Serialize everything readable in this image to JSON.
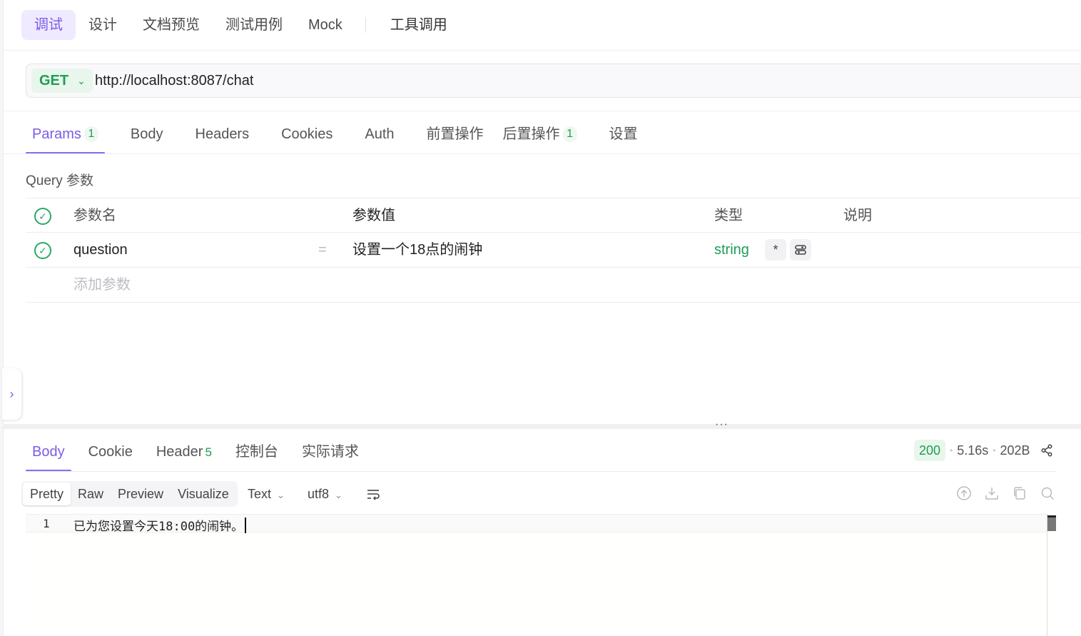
{
  "top_tabs": {
    "items": [
      {
        "label": "调试",
        "active": true
      },
      {
        "label": "设计"
      },
      {
        "label": "文档预览"
      },
      {
        "label": "测试用例"
      },
      {
        "label": "Mock"
      }
    ],
    "extra": "工具调用"
  },
  "request": {
    "method": "GET",
    "url": "http://localhost:8087/chat"
  },
  "request_tabs": [
    {
      "label": "Params",
      "count": "1"
    },
    {
      "label": "Body"
    },
    {
      "label": "Headers"
    },
    {
      "label": "Cookies"
    },
    {
      "label": "Auth"
    },
    {
      "label": "前置操作"
    },
    {
      "label": "后置操作",
      "count": "1"
    },
    {
      "label": "设置"
    }
  ],
  "query": {
    "section_label": "Query 参数",
    "columns": {
      "name": "参数名",
      "value": "参数值",
      "type": "类型",
      "desc": "说明"
    },
    "rows": [
      {
        "name": "question",
        "eq": "=",
        "value": "设置一个18点的闹钟",
        "type": "string",
        "required_mark": "*"
      }
    ],
    "add_placeholder": "添加参数"
  },
  "response_tabs": [
    {
      "label": "Body",
      "active": true
    },
    {
      "label": "Cookie"
    },
    {
      "label": "Header",
      "count": "5"
    },
    {
      "label": "控制台"
    },
    {
      "label": "实际请求"
    }
  ],
  "response_meta": {
    "status": "200",
    "time": "5.16s",
    "size": "202B"
  },
  "view_modes": [
    "Pretty",
    "Raw",
    "Preview",
    "Visualize"
  ],
  "format": {
    "type": "Text",
    "encoding": "utf8"
  },
  "editor": {
    "line_number": "1",
    "content": "已为您设置今天18:00的闹钟。"
  },
  "colors": {
    "accent": "#7b5ce6",
    "success": "#1f9d55"
  },
  "icons": [
    "chevron-down-icon",
    "check-icon",
    "share-icon",
    "wrap-lines-icon",
    "upload-icon",
    "download-icon",
    "copy-icon",
    "search-icon",
    "chevron-right-icon"
  ]
}
